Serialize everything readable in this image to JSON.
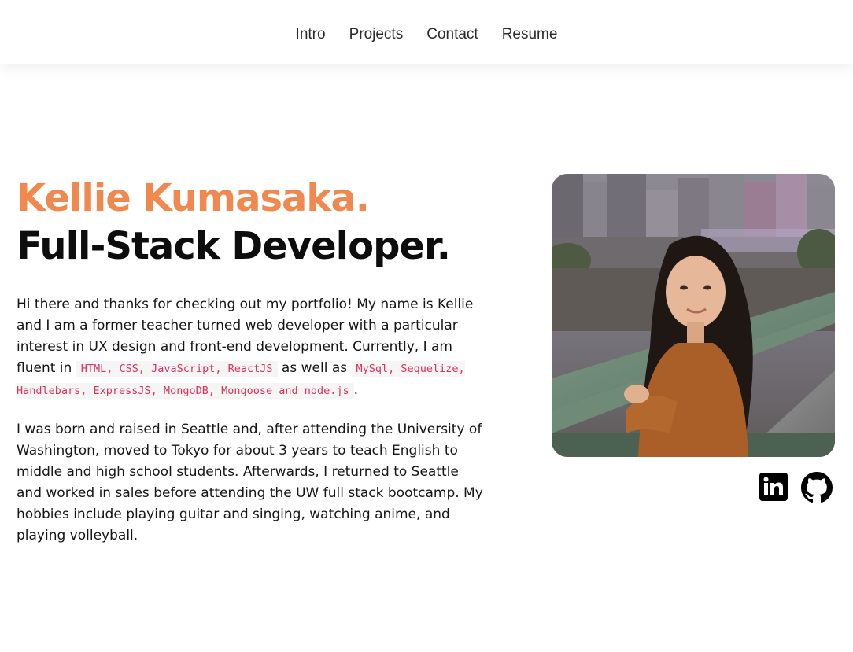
{
  "nav": {
    "links": [
      {
        "label": "Intro"
      },
      {
        "label": "Projects"
      },
      {
        "label": "Contact"
      },
      {
        "label": "Resume"
      }
    ]
  },
  "hero": {
    "name": "Kellie Kumasaka.",
    "role": "Full-Stack Developer.",
    "bio1": {
      "intro": "Hi there and thanks for checking out my portfolio! My name is Kellie and I am a former teacher turned web developer with a particular interest in UX design and front-end development. Currently, I am fluent in ",
      "frontend_skills": "HTML, CSS, JavaScript, ReactJS",
      "connector": " as well as ",
      "backend_skills": "MySql, Sequelize, Handlebars, ExpressJS, MongoDB, Mongoose and node.js",
      "end": "."
    },
    "bio2": "I was born and raised in Seattle and, after attending the University of Washington, moved to Tokyo for about 3 years to teach English to middle and high school students. Afterwards, I returned to Seattle and worked in sales before attending the UW full stack bootcamp. My hobbies include playing guitar and singing, watching anime, and playing volleyball."
  },
  "social": {
    "icons": [
      "linkedin-icon",
      "github-icon"
    ]
  },
  "colors": {
    "accent": "#f0894f",
    "code_text": "#e0315b",
    "code_bg": "#f5f5f5",
    "text": "#111111"
  }
}
